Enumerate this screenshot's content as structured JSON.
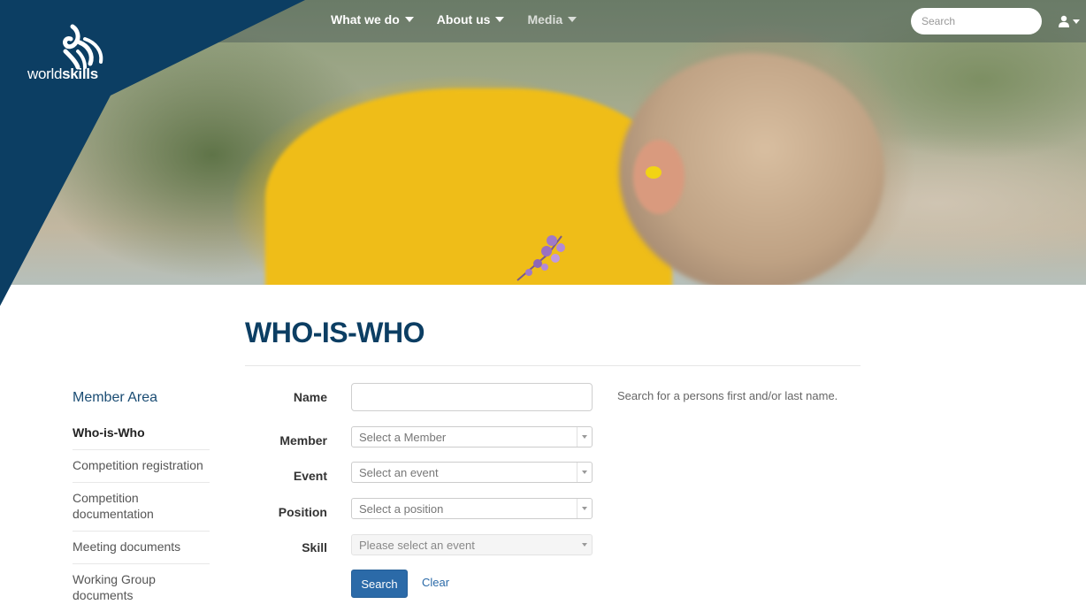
{
  "brand": {
    "logo_word_light": "world",
    "logo_word_bold": "skills",
    "color": "#0c3e63"
  },
  "nav": {
    "items": [
      {
        "label": "What we do"
      },
      {
        "label": "About us"
      },
      {
        "label": "Media"
      }
    ],
    "search_placeholder": "Search",
    "user_icon": "user-icon"
  },
  "page": {
    "title": "WHO-IS-WHO"
  },
  "sidebar": {
    "heading": "Member Area",
    "items": [
      {
        "label": "Who-is-Who",
        "active": true
      },
      {
        "label": "Competition registration"
      },
      {
        "label": "Competition documentation"
      },
      {
        "label": "Meeting documents"
      },
      {
        "label": "Working Group documents"
      }
    ]
  },
  "form": {
    "name_label": "Name",
    "name_value": "",
    "name_help": "Search for a persons first and/or last name.",
    "member_label": "Member",
    "member_placeholder": "Select a Member",
    "event_label": "Event",
    "event_placeholder": "Select an event",
    "position_label": "Position",
    "position_placeholder": "Select a position",
    "skill_label": "Skill",
    "skill_placeholder": "Please select an event",
    "search_button": "Search",
    "clear_link": "Clear"
  },
  "colors": {
    "primary_button": "#2b6aa8",
    "title": "#0c3e63"
  }
}
